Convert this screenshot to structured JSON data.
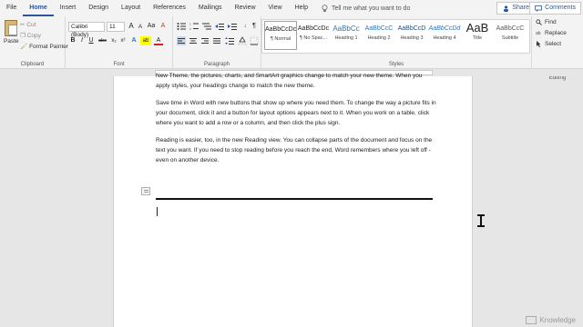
{
  "tabs": [
    "File",
    "Home",
    "Insert",
    "Design",
    "Layout",
    "References",
    "Mailings",
    "Review",
    "View",
    "Help"
  ],
  "active_tab": "Home",
  "tell_me": {
    "icon": "lightbulb-icon",
    "placeholder": "Tell me what you want to do"
  },
  "share_label": "Share",
  "comments_label": "Comments",
  "clipboard": {
    "paste": "Paste",
    "cut": "Cut",
    "copy": "Copy",
    "format_painter": "Format Painter",
    "label": "Clipboard"
  },
  "font": {
    "name": "Calibri (Body)",
    "size": "11",
    "grow": "A",
    "shrink": "A",
    "case": "Aa",
    "clear": "A",
    "bold": "B",
    "italic": "I",
    "underline": "U",
    "strike": "abc",
    "sub": "x₂",
    "sup": "x²",
    "effects": "A",
    "highlight": "ab",
    "color": "A",
    "label": "Font"
  },
  "paragraph": {
    "label": "Paragraph",
    "pilcrow": "¶"
  },
  "styles": {
    "label": "Styles",
    "items": [
      {
        "preview": "AaBbCcDc",
        "name": "¶ Normal"
      },
      {
        "preview": "AaBbCcDc",
        "name": "¶ No Spac..."
      },
      {
        "preview": "AaBbCc",
        "name": "Heading 1"
      },
      {
        "preview": "AaBbCcC",
        "name": "Heading 2"
      },
      {
        "preview": "AaBbCcD",
        "name": "Heading 3"
      },
      {
        "preview": "AaBbCcDd",
        "name": "Heading 4"
      },
      {
        "preview": "AaB",
        "name": "Title"
      },
      {
        "preview": "AaBbCcC",
        "name": "Subtitle"
      }
    ]
  },
  "editing": {
    "find": "Find",
    "replace": "Replace",
    "select": "Select",
    "label": "Editing"
  },
  "document": {
    "p0": "New Theme, the pictures, charts, and SmartArt graphics change to match your new theme. When you apply styles, your headings change to match the new theme.",
    "p1": "Save time in Word with new buttons that show up where you need them. To change the way a picture fits in your document, click it and a button for layout options appears next to it. When you work on a table, click where you want to add a row or a column, and then click the plus sign.",
    "p2": "Reading is easier, too, in the new Reading view. You can collapse parts of the document and focus on the text you want. If you need to stop reading before you reach the end, Word remembers where you left off - even on another device."
  },
  "watermark": "Knowledge"
}
